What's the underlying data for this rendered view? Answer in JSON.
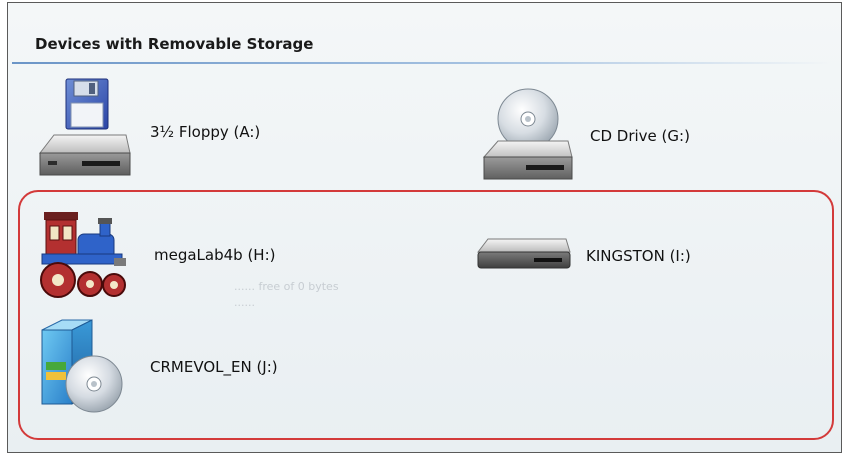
{
  "section": {
    "title": "Devices with Removable Storage"
  },
  "devices": [
    {
      "label": "3½ Floppy (A:)",
      "icon": "floppy-drive-icon"
    },
    {
      "label": "CD Drive (G:)",
      "icon": "cd-drive-icon"
    },
    {
      "label": "megaLab4b (H:)",
      "icon": "toy-train-icon"
    },
    {
      "label": "KINGSTON (I:)",
      "icon": "removable-disk-icon"
    },
    {
      "label": "CRMEVOL_EN (J:)",
      "icon": "cd-installer-icon"
    }
  ],
  "colors": {
    "highlight": "#d33a3a",
    "title_rule": "#6b95c7",
    "pane_background": "#eef2f4"
  }
}
